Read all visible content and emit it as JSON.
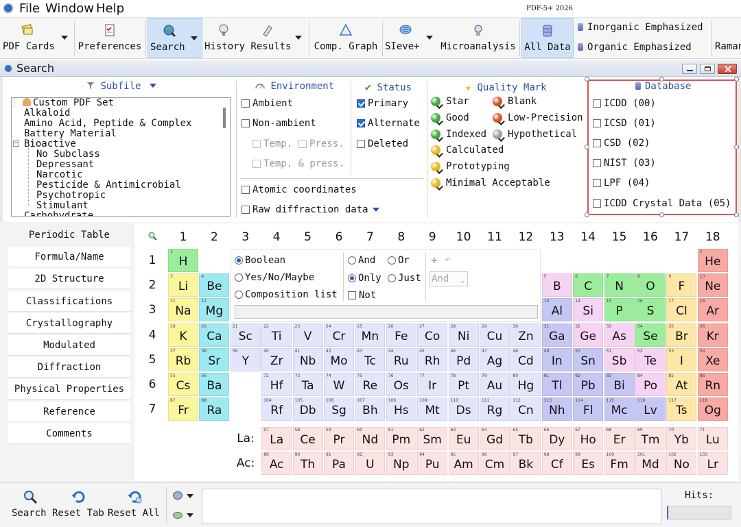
{
  "menu": {
    "items": [
      "File",
      "Window",
      "Help"
    ],
    "version": "PDF-5+ 2026"
  },
  "toolbar": {
    "buttons": [
      "PDF Cards",
      "Preferences",
      "Search",
      "History Results",
      "Comp. Graph",
      "SIeve+",
      "Microanalysis",
      "All Data",
      "Raman"
    ],
    "options": [
      "Inorganic Emphasized",
      "Organic Emphasized"
    ]
  },
  "window": {
    "title": "Search"
  },
  "subfile": {
    "title": "Subfile",
    "items": [
      "Custom PDF Set",
      "Alkaloid",
      "Amino Acid, Peptide & Complex",
      "Battery Material",
      "Bioactive",
      "No Subclass",
      "Depressant",
      "Narcotic",
      "Pesticide & Antimicrobial",
      "Psychotropic",
      "Stimulant",
      "Carbohydrate"
    ]
  },
  "environment": {
    "title": "Environment",
    "options": [
      "Ambient",
      "Non-ambient"
    ],
    "sub_options": [
      "Temp.",
      "Press.",
      "Temp. & press."
    ],
    "extra": [
      "Atomic coordinates",
      "Raw diffraction data"
    ]
  },
  "status": {
    "title": "Status",
    "options": [
      {
        "label": "Primary",
        "checked": true
      },
      {
        "label": "Alternate",
        "checked": true
      },
      {
        "label": "Deleted",
        "checked": false
      }
    ]
  },
  "quality": {
    "title": "Quality Mark",
    "items": [
      {
        "label": "Star",
        "color": "#3fae3a"
      },
      {
        "label": "Blank",
        "color": "#e0502a"
      },
      {
        "label": "Good",
        "color": "#3fae3a"
      },
      {
        "label": "Low-Precision",
        "color": "#e0502a"
      },
      {
        "label": "Indexed",
        "color": "#3fae3a"
      },
      {
        "label": "Hypothetical",
        "color": "#a0a0a0"
      },
      {
        "label": "Calculated",
        "color": "#e8b81c"
      },
      {
        "label": "Prototyping",
        "color": "#e8b81c"
      },
      {
        "label": "Minimal Acceptable",
        "color": "#e8b81c"
      }
    ]
  },
  "database": {
    "title": "Database",
    "items": [
      "ICDD (00)",
      "ICSD (01)",
      "CSD (02)",
      "NIST (03)",
      "LPF (04)",
      "ICDD Crystal Data (05)"
    ]
  },
  "tabs": [
    "Periodic Table",
    "Formula/Name",
    "2D Structure",
    "Classifications",
    "Crystallography",
    "Modulated",
    "Diffraction",
    "Physical Properties",
    "Reference",
    "Comments"
  ],
  "periodic": {
    "groups": [
      "1",
      "2",
      "3",
      "4",
      "5",
      "6",
      "7",
      "8",
      "9",
      "10",
      "11",
      "12",
      "13",
      "14",
      "15",
      "16",
      "17",
      "18"
    ],
    "periods": [
      "1",
      "2",
      "3",
      "4",
      "5",
      "6",
      "7"
    ],
    "la_label": "La:",
    "ac_label": "Ac:",
    "modes": [
      "Boolean",
      "Yes/No/Maybe",
      "Composition list"
    ],
    "logic": [
      "And",
      "Or",
      "Only",
      "Just",
      "Not"
    ],
    "combo": "And",
    "elements": [
      [
        "1",
        "H",
        0,
        0,
        "g"
      ],
      [
        "2",
        "He",
        17,
        0,
        "r"
      ],
      [
        "3",
        "Li",
        0,
        1,
        "y"
      ],
      [
        "4",
        "Be",
        1,
        1,
        "c"
      ],
      [
        "5",
        "B",
        12,
        1,
        "p"
      ],
      [
        "6",
        "C",
        13,
        1,
        "g"
      ],
      [
        "7",
        "N",
        14,
        1,
        "g"
      ],
      [
        "8",
        "O",
        15,
        1,
        "g"
      ],
      [
        "9",
        "F",
        16,
        1,
        "o"
      ],
      [
        "10",
        "Ne",
        17,
        1,
        "r"
      ],
      [
        "11",
        "Na",
        0,
        2,
        "y"
      ],
      [
        "12",
        "Mg",
        1,
        2,
        "c"
      ],
      [
        "13",
        "Al",
        12,
        2,
        "b"
      ],
      [
        "14",
        "Si",
        13,
        2,
        "p"
      ],
      [
        "15",
        "P",
        14,
        2,
        "g"
      ],
      [
        "16",
        "S",
        15,
        2,
        "g"
      ],
      [
        "17",
        "Cl",
        16,
        2,
        "o"
      ],
      [
        "18",
        "Ar",
        17,
        2,
        "r"
      ],
      [
        "19",
        "K",
        0,
        3,
        "y"
      ],
      [
        "20",
        "Ca",
        1,
        3,
        "c"
      ],
      [
        "21",
        "Sc",
        2,
        3,
        "l"
      ],
      [
        "22",
        "Ti",
        3,
        3,
        "l"
      ],
      [
        "23",
        "V",
        4,
        3,
        "l"
      ],
      [
        "24",
        "Cr",
        5,
        3,
        "l"
      ],
      [
        "25",
        "Mn",
        6,
        3,
        "l"
      ],
      [
        "26",
        "Fe",
        7,
        3,
        "l"
      ],
      [
        "27",
        "Co",
        8,
        3,
        "l"
      ],
      [
        "28",
        "Ni",
        9,
        3,
        "l"
      ],
      [
        "29",
        "Cu",
        10,
        3,
        "l"
      ],
      [
        "30",
        "Zn",
        11,
        3,
        "l"
      ],
      [
        "31",
        "Ga",
        12,
        3,
        "b"
      ],
      [
        "32",
        "Ge",
        13,
        3,
        "p"
      ],
      [
        "33",
        "As",
        14,
        3,
        "p"
      ],
      [
        "34",
        "Se",
        15,
        3,
        "g"
      ],
      [
        "35",
        "Br",
        16,
        3,
        "o"
      ],
      [
        "36",
        "Kr",
        17,
        3,
        "r"
      ],
      [
        "37",
        "Rb",
        0,
        4,
        "y"
      ],
      [
        "38",
        "Sr",
        1,
        4,
        "c"
      ],
      [
        "39",
        "Y",
        2,
        4,
        "l"
      ],
      [
        "40",
        "Zr",
        3,
        4,
        "l"
      ],
      [
        "41",
        "Nb",
        4,
        4,
        "l"
      ],
      [
        "42",
        "Mo",
        5,
        4,
        "l"
      ],
      [
        "43",
        "Tc",
        6,
        4,
        "l"
      ],
      [
        "44",
        "Ru",
        7,
        4,
        "l"
      ],
      [
        "45",
        "Rh",
        8,
        4,
        "l"
      ],
      [
        "46",
        "Pd",
        9,
        4,
        "l"
      ],
      [
        "47",
        "Ag",
        10,
        4,
        "l"
      ],
      [
        "48",
        "Cd",
        11,
        4,
        "l"
      ],
      [
        "49",
        "In",
        12,
        4,
        "b"
      ],
      [
        "50",
        "Sn",
        13,
        4,
        "b"
      ],
      [
        "51",
        "Sb",
        14,
        4,
        "p"
      ],
      [
        "52",
        "Te",
        15,
        4,
        "p"
      ],
      [
        "53",
        "I",
        16,
        4,
        "o"
      ],
      [
        "54",
        "Xe",
        17,
        4,
        "r"
      ],
      [
        "55",
        "Cs",
        0,
        5,
        "y"
      ],
      [
        "56",
        "Ba",
        1,
        5,
        "c"
      ],
      [
        "72",
        "Hf",
        3,
        5,
        "l"
      ],
      [
        "73",
        "Ta",
        4,
        5,
        "l"
      ],
      [
        "74",
        "W",
        5,
        5,
        "l"
      ],
      [
        "75",
        "Re",
        6,
        5,
        "l"
      ],
      [
        "76",
        "Os",
        7,
        5,
        "l"
      ],
      [
        "77",
        "Ir",
        8,
        5,
        "l"
      ],
      [
        "78",
        "Pt",
        9,
        5,
        "l"
      ],
      [
        "79",
        "Au",
        10,
        5,
        "l"
      ],
      [
        "80",
        "Hg",
        11,
        5,
        "l"
      ],
      [
        "81",
        "Tl",
        12,
        5,
        "b"
      ],
      [
        "82",
        "Pb",
        13,
        5,
        "b"
      ],
      [
        "83",
        "Bi",
        14,
        5,
        "b"
      ],
      [
        "84",
        "Po",
        15,
        5,
        "p"
      ],
      [
        "85",
        "At",
        16,
        5,
        "o"
      ],
      [
        "86",
        "Rn",
        17,
        5,
        "r"
      ],
      [
        "87",
        "Fr",
        0,
        6,
        "y"
      ],
      [
        "88",
        "Ra",
        1,
        6,
        "c"
      ],
      [
        "104",
        "Rf",
        3,
        6,
        "l"
      ],
      [
        "105",
        "Db",
        4,
        6,
        "l"
      ],
      [
        "106",
        "Sg",
        5,
        6,
        "l"
      ],
      [
        "107",
        "Bh",
        6,
        6,
        "l"
      ],
      [
        "108",
        "Hs",
        7,
        6,
        "l"
      ],
      [
        "109",
        "Mt",
        8,
        6,
        "l"
      ],
      [
        "110",
        "Ds",
        9,
        6,
        "l"
      ],
      [
        "111",
        "Rg",
        10,
        6,
        "l"
      ],
      [
        "112",
        "Cn",
        11,
        6,
        "l"
      ],
      [
        "113",
        "Nh",
        12,
        6,
        "b"
      ],
      [
        "114",
        "Fl",
        13,
        6,
        "b"
      ],
      [
        "115",
        "Mc",
        14,
        6,
        "b"
      ],
      [
        "116",
        "Lv",
        15,
        6,
        "b"
      ],
      [
        "117",
        "Ts",
        16,
        6,
        "o"
      ],
      [
        "118",
        "Og",
        17,
        6,
        "r"
      ],
      [
        "57",
        "La",
        3,
        7,
        "k"
      ],
      [
        "58",
        "Ce",
        4,
        7,
        "k"
      ],
      [
        "59",
        "Pr",
        5,
        7,
        "k"
      ],
      [
        "60",
        "Nd",
        6,
        7,
        "k"
      ],
      [
        "61",
        "Pm",
        7,
        7,
        "k"
      ],
      [
        "62",
        "Sm",
        8,
        7,
        "k"
      ],
      [
        "63",
        "Eu",
        9,
        7,
        "k"
      ],
      [
        "64",
        "Gd",
        10,
        7,
        "k"
      ],
      [
        "65",
        "Tb",
        11,
        7,
        "k"
      ],
      [
        "66",
        "Dy",
        12,
        7,
        "k"
      ],
      [
        "67",
        "Ho",
        13,
        7,
        "k"
      ],
      [
        "68",
        "Er",
        14,
        7,
        "k"
      ],
      [
        "69",
        "Tm",
        15,
        7,
        "k"
      ],
      [
        "70",
        "Yb",
        16,
        7,
        "k"
      ],
      [
        "71",
        "Lu",
        17,
        7,
        "k"
      ],
      [
        "89",
        "Ac",
        3,
        8,
        "k"
      ],
      [
        "90",
        "Th",
        4,
        8,
        "k"
      ],
      [
        "91",
        "Pa",
        5,
        8,
        "k"
      ],
      [
        "92",
        "U",
        6,
        8,
        "k"
      ],
      [
        "93",
        "Np",
        7,
        8,
        "k"
      ],
      [
        "94",
        "Pu",
        8,
        8,
        "k"
      ],
      [
        "95",
        "Am",
        9,
        8,
        "k"
      ],
      [
        "96",
        "Cm",
        10,
        8,
        "k"
      ],
      [
        "97",
        "Bk",
        11,
        8,
        "k"
      ],
      [
        "98",
        "Cf",
        12,
        8,
        "k"
      ],
      [
        "99",
        "Es",
        13,
        8,
        "k"
      ],
      [
        "100",
        "Fm",
        14,
        8,
        "k"
      ],
      [
        "101",
        "Md",
        15,
        8,
        "k"
      ],
      [
        "102",
        "No",
        16,
        8,
        "k"
      ],
      [
        "103",
        "Lr",
        17,
        8,
        "k"
      ]
    ],
    "colors": {
      "g": "#9bec9b",
      "r": "#f7aaa4",
      "y": "#fbf59c",
      "c": "#9de9ef",
      "p": "#f6d3f2",
      "b": "#c6c6f5",
      "o": "#fde6a6",
      "l": "#e3e5fb",
      "k": "#fce3e3"
    }
  },
  "bottom": {
    "buttons": [
      "Search",
      "Reset Tab",
      "Reset All"
    ],
    "hits_label": "Hits:"
  }
}
